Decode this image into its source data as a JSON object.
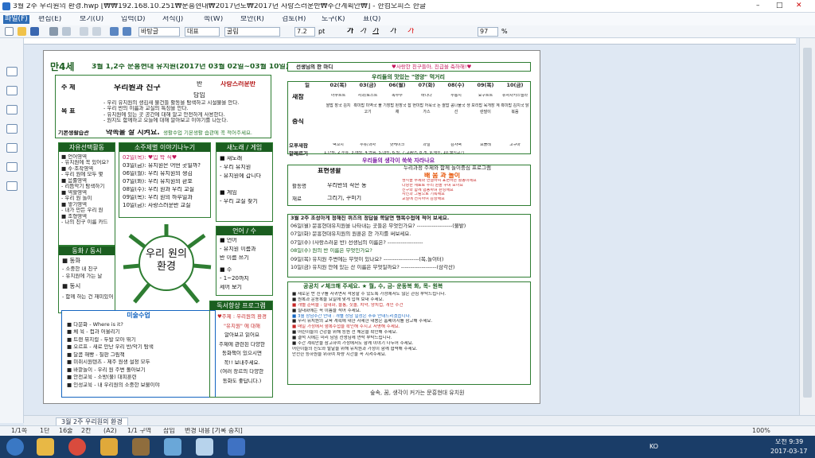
{
  "window": {
    "title": "3월 2주 우리원의 환경.hwp [₩₩192.168.10.251₩문흥현대₩2017년도₩2017년 사랑스러운반₩주간계획안₩] - 한컴오피스 한글",
    "controls": [
      "–",
      "□",
      "✕"
    ]
  },
  "menu": {
    "items": [
      "파일(F)",
      "편집(E)",
      "보기(U)",
      "입력(D)",
      "서식(J)",
      "쪽(W)",
      "보안(R)",
      "검토(H)",
      "도구(K)",
      "표(Q)"
    ]
  },
  "toolbar": {
    "style": "바탕글",
    "font_type": "대표",
    "font": "굴림",
    "size": "7.2",
    "unit": "pt",
    "zoom": "97",
    "zoom_unit": "%",
    "bold": "가",
    "italic": "가",
    "underline": "가",
    "strike": "가",
    "color_a": "가"
  },
  "doc": {
    "age": "만4세",
    "week_title": "3월 1,2주 문흥현대 유치원(2017년 03월 02일~03월 10일)",
    "theme_label": "주 제",
    "theme_value": "우리원과 친구",
    "class_label": "반",
    "class_value": "사랑스러운반",
    "teacher_label": "담임",
    "goal_label": "목 표",
    "goals": [
      "- 우리 유치원의 생김새 물건들 활동을 탐색하고 시설물을 안다.",
      "- 우리 반의 이름과 교실의 특징을 안다.",
      "- 유치원에 있는 곳 공간에 대해 알고 안전하게 사용한다.",
      "- 원지도 함께하고 오늘에 대해 알아보고 이야기를 나눈다."
    ],
    "habit_label": "기본생활습관",
    "habit_value": "약속을 잘 지켜요.",
    "habit_note": "생활수업 기본생활 습관에 꼭 적어주세요.",
    "free_title": "자유선택활동",
    "free_items": [
      "■ 언어영역",
      "- 유치원에 꼭 있어요?",
      "■ 수·조작영역",
      "- 우리 원에 모두 몇",
      "■ 음률영역",
      "- 리듬악기 탐색하기",
      "■ 역할영역",
      "- 우리 원 놀이",
      "■ 쌓기영역",
      "- 내가 만든 우리 원",
      "■ 조형영역",
      "- 나의 친구 이름 카드"
    ],
    "small_title": "소주제별 이야기나누기",
    "small_items": [
      "02일(목): ♥입 학 식♥",
      "03일(금): 유치원은 어떤 곳일까?",
      "06일(월): 우리 유치원의 생김",
      "07일(화): 우리 유치원의 환호",
      "08일(수): 우리 원과 우리 교실",
      "09일(목): 우리 원의 하루일과",
      "10일(금): 사랑스러운반 교실"
    ],
    "song_title": "새노래 / 게임",
    "song_items": [
      "■ 새노래",
      "- 우리 유치원",
      "- 유치원에 갑니다",
      "■ 게임",
      "- 우리 교실 찾기"
    ],
    "center_text": "우리 원의 환경",
    "move_title": "동화 / 동시",
    "move_items": [
      "■ 동화",
      "- 소중한 내 친구",
      "- 유치원에 가는 날",
      "■ 동시",
      "- 함께 하는 건 재미있어"
    ],
    "lang_title": "언어 / 수",
    "lang_items": [
      "■ 언어",
      "- 유치원 이름과",
      "  반 이름 쓰기",
      "■ 수",
      "- 1~20까지",
      "  세어 보기"
    ],
    "reading_title": "독서향상 프로그램",
    "reading_items": [
      "♥주제 : 우리원의 환경",
      "\"유치원\" 에 대해",
      "알아보고 읽어요",
      "주제에 관련된 다양한",
      "동화책이 있으시면",
      "꼭!! 보내주세요.",
      "(여러 장르의 다양한",
      "동화도 좋답니다.)"
    ],
    "special_title": "미술수업",
    "special_items": [
      "■ 다문화 - Where is it?",
      "■ 체 육 - 컵과 어울리기",
      "■ 트랜 뮤지컬 - 두발 모아 뛰기",
      "■ 오르프 - 새로 만난 우리 반/악기 탐색",
      "■ 달콤 해빵 - 칠판 그림책",
      "■ 미취시원텐츠 - 제주 원생 설정 모두",
      "■ 바깥놀이 - 우리 원 주변 돌아보기",
      "■ 안전교육 - 소방(불) 대피훈련",
      "■ 인성교육 - 내 우리원의 소중한 보물이야"
    ],
    "corner_title": "선생님의 한 마디",
    "corner_note": "♥사랑한 친구들아, 진급을 축하해!♥",
    "snack_title": "우리들의 맛있는 \"영양\" 먹거리",
    "days": [
      "일",
      "02(목)",
      "03(금)",
      "06(월)",
      "07(화)",
      "08(수)",
      "09(목)",
      "10(금)"
    ],
    "meal_rows": [
      "새참",
      "중식",
      "오후새참",
      "알레르기"
    ],
    "snack_row": [
      "아쿠르트",
      "사과/토스트",
      "옥수수",
      "바나나",
      "누룽지",
      "요구르트",
      "유자차카스텔라"
    ],
    "lunch_row": [
      "쌀밥 장국 김치",
      "흑미밥 미역국 불고기",
      "기장밥 된장국 잡채",
      "현미밥 어묵국 돈가스",
      "쌀밥 콩나물국 생선",
      "보리밥 육개장 계란말이",
      "흑미밥 김치국 닭볶음"
    ],
    "pm_row": [
      "떡꼬치",
      "우유/과자",
      "핫케이크",
      "과일",
      "감자떡",
      "요플레",
      "고구마"
    ],
    "allergy_note": "1.난류, 2.우유, 3.메밀, 4.땅콩, 5.대두, 6.밀, 7.고등어, 8.게, 9.새우, 10.돼지고기",
    "play_banner": "우리들의 생각이 쑥쑥 자라나요",
    "table_title": "표현생활",
    "table_subtitle": "누리과정 주제와 함께 놀이중심 프로그램",
    "table_name": "배 움 과 놀이",
    "table_rows": [
      {
        "label": "활동명",
        "value": "우리반의 작은 동"
      },
      {
        "label": "재료",
        "value": "그리기, 꾸미기"
      }
    ],
    "table_desc": [
      "생각을 주제와 연결하여 표현하는 활동이에요",
      "다양한 재료로 우리 원을 꾸며 보아요",
      "친구와 함께 협동하며 완성해요",
      "사진과 그림으로 기록해요",
      "교실에 전시하여 감상해요"
    ],
    "quiz_title": "3월 2주 초성아게 정해진 퀴즈의 정답을 쪽달면 행복수첩에 적어 보세요.",
    "quiz_items": [
      "06일(월) 문흥현대유치원을 나타내는 곳들은 무엇인가요? -------------------(불밭)",
      "07일(화) 문흥현대유치원의 원훈은 한 가지를 써보세요.",
      "07일(수) (사랑스러운 반) 선생님의 이름은? -------------------",
      "08일(수) 원의 반 이름은 무엇인가요?",
      "09일(목) 유치원 주변에는 무엇이 있나요? -------------------(목,놀이터)",
      "10일(금) 유치원 안에 있는 산 이름은 무엇일까요? -------------------(삼각산)"
    ],
    "notice_title": "공공치 ✔체크해 주세요. ★ 월, 수, 금- 운동복 화, 목- 원복",
    "notices": [
      "■ 새로운 반 친구를 사귀면서 적응할 수 있도록 가정에서도 많은 관심 부탁드립니다.",
      "■ 원복과 운동복을 요일에 맞게 입혀 보내 주세요.",
      "■ 개별 준비물 : 실내화, 물통, 칫솔, 치약, 양치컵, 개인 수건",
      "■ 실내화에는 꼭 이름을 적어 주세요.",
      "■ 3월 상담주간 안내 : 개별 상담 일정은 추후 안내드리겠습니다.",
      "■ 우리 유치원의 교육 계획에 대한 자세한 내용은 홈페이지를 참고해 주세요.",
      "■ 매일 가정에서 행복수첩을 확인해 주시고 서명해 주세요.",
      "■ 어린이들의 건강을 위해 등원 전 체온을 확인해 주세요.",
      "■ 결석 시에는 미리 담임 선생님께 연락 부탁드립니다.",
      "■ 주간 계획안을 참고하여 가정에서도 함께 이야기 나누어 주세요.",
      "어린이들의 진도와 발달을 위해 유치원과 가정이 함께 협력해 주세요.",
      "안전한 등하원을 위하여 차량 시간을 꼭 지켜주세요."
    ],
    "footer": "숲속, 꿈, 생각이 커가는 문흥현대 유치원"
  },
  "tabs": {
    "active": "3월 2주 우리원의 환경"
  },
  "status": {
    "page": "1/1쪽",
    "section": "1단",
    "line": "16줄",
    "col": "2칸",
    "mode": "(A2)",
    "section2": "1/1 구역",
    "insert": "삽입",
    "changes": "변경 내용 [기록 중지]",
    "zoom": "100%"
  },
  "taskbar": {
    "time": "오전 9:39",
    "date": "2017-03-17",
    "lang": "KO"
  }
}
